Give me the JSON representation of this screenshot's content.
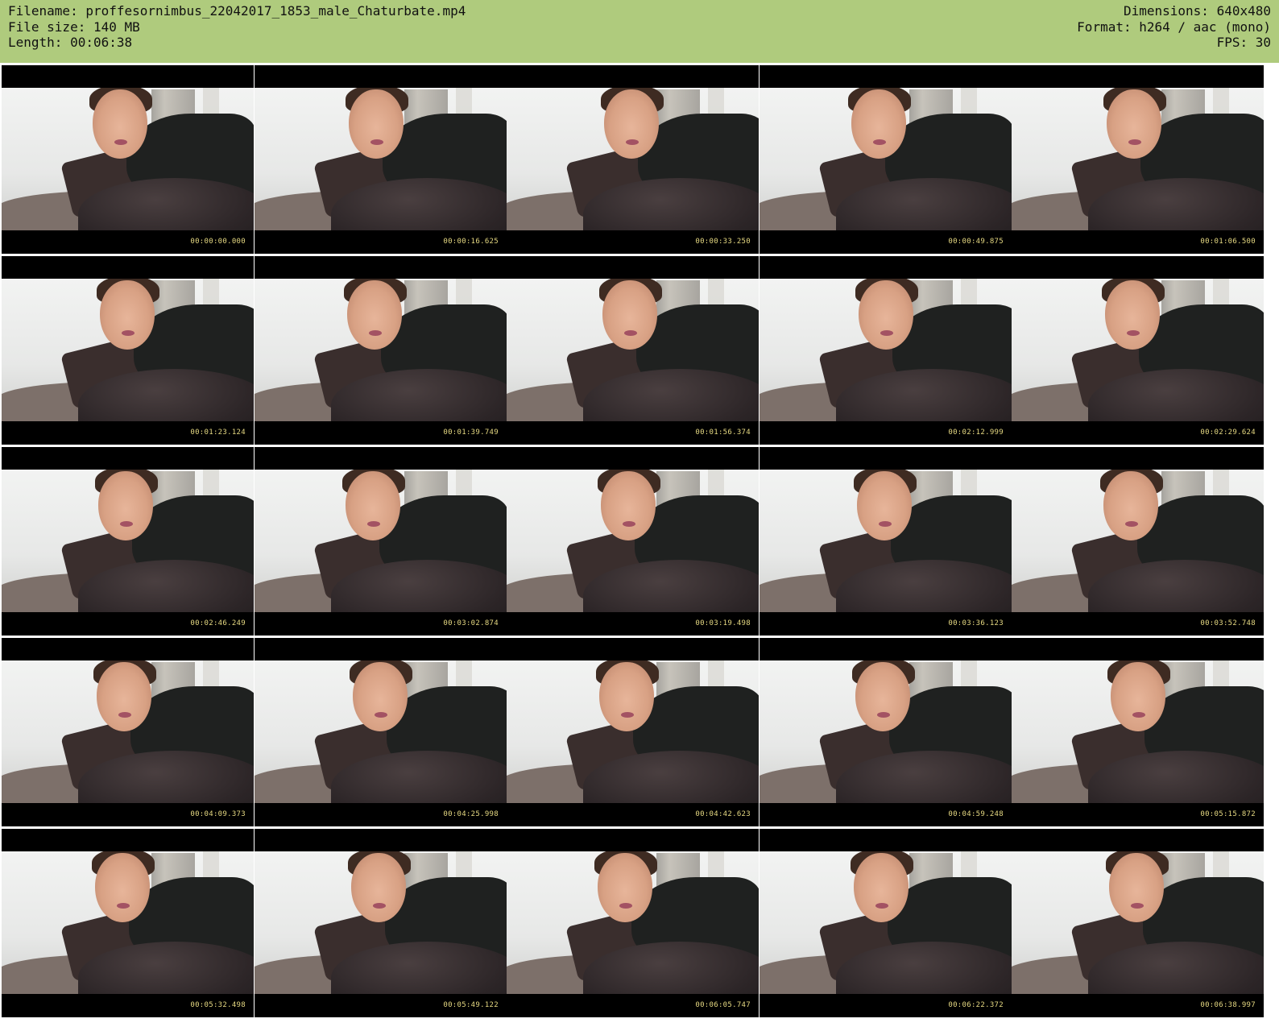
{
  "header": {
    "filename": "Filename: proffesornimbus_22042017_1853_male_Chaturbate.mp4",
    "filesize": "File size: 140 MB",
    "length": "Length: 00:06:38",
    "dimensions": "Dimensions: 640x480",
    "format": "Format: h264 / aac (mono)",
    "fps": "FPS: 30"
  },
  "colors": {
    "header_bg": "#afcb7d",
    "timestamp": "#e6d982"
  },
  "grid": {
    "columns": 5,
    "rows": 5,
    "timestamps": [
      "00:00:00.000",
      "00:00:16.625",
      "00:00:33.250",
      "00:00:49.875",
      "00:01:06.500",
      "00:01:23.124",
      "00:01:39.749",
      "00:01:56.374",
      "00:02:12.999",
      "00:02:29.624",
      "00:02:46.249",
      "00:03:02.874",
      "00:03:19.498",
      "00:03:36.123",
      "00:03:52.748",
      "00:04:09.373",
      "00:04:25.998",
      "00:04:42.623",
      "00:04:59.248",
      "00:05:15.872",
      "00:05:32.498",
      "00:05:49.122",
      "00:06:05.747",
      "00:06:22.372",
      "00:06:38.997"
    ]
  }
}
